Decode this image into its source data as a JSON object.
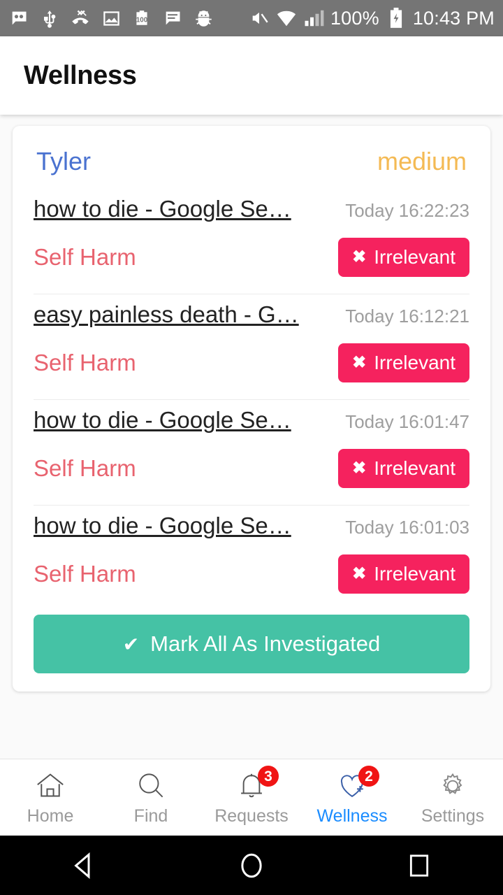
{
  "statusbar": {
    "icons_left": [
      "voicemail-icon",
      "usb-icon",
      "missed-call-icon",
      "image-icon",
      "battery-100-icon",
      "message-icon",
      "android-bug-icon"
    ],
    "icons_right": [
      "mute-icon",
      "wifi-icon",
      "signal-icon",
      "charging-battery-icon"
    ],
    "battery_percent": "100%",
    "clock": "10:43 PM"
  },
  "header": {
    "title": "Wellness"
  },
  "card": {
    "owner": "Tyler",
    "risk": "medium",
    "entries": [
      {
        "title": "how to die - Google Se…",
        "time": "Today 16:22:23",
        "category": "Self Harm",
        "action_label": "Irrelevant"
      },
      {
        "title": "easy painless death - G…",
        "time": "Today 16:12:21",
        "category": "Self Harm",
        "action_label": "Irrelevant"
      },
      {
        "title": "how to die - Google Se…",
        "time": "Today 16:01:47",
        "category": "Self Harm",
        "action_label": "Irrelevant"
      },
      {
        "title": "how to die - Google Se…",
        "time": "Today 16:01:03",
        "category": "Self Harm",
        "action_label": "Irrelevant"
      }
    ],
    "mark_all_label": "Mark All As Investigated"
  },
  "bottomnav": {
    "items": [
      {
        "label": "Home",
        "icon": "home-icon",
        "badge": "",
        "active": false
      },
      {
        "label": "Find",
        "icon": "search-icon",
        "badge": "",
        "active": false
      },
      {
        "label": "Requests",
        "icon": "bell-icon",
        "badge": "3",
        "active": false
      },
      {
        "label": "Wellness",
        "icon": "heart-plus-icon",
        "badge": "2",
        "active": true
      },
      {
        "label": "Settings",
        "icon": "gear-icon",
        "badge": "",
        "active": false
      }
    ]
  },
  "androidnav": {
    "buttons": [
      "back-icon",
      "home-circle-icon",
      "recents-icon"
    ]
  },
  "colors": {
    "accent_blue": "#4a72d0",
    "risk_medium": "#f4ba54",
    "category_red": "#e8636f",
    "button_pink": "#f5225e",
    "button_green": "#45c2a5",
    "badge_red": "#f01414",
    "active_nav": "#1a8cff"
  }
}
